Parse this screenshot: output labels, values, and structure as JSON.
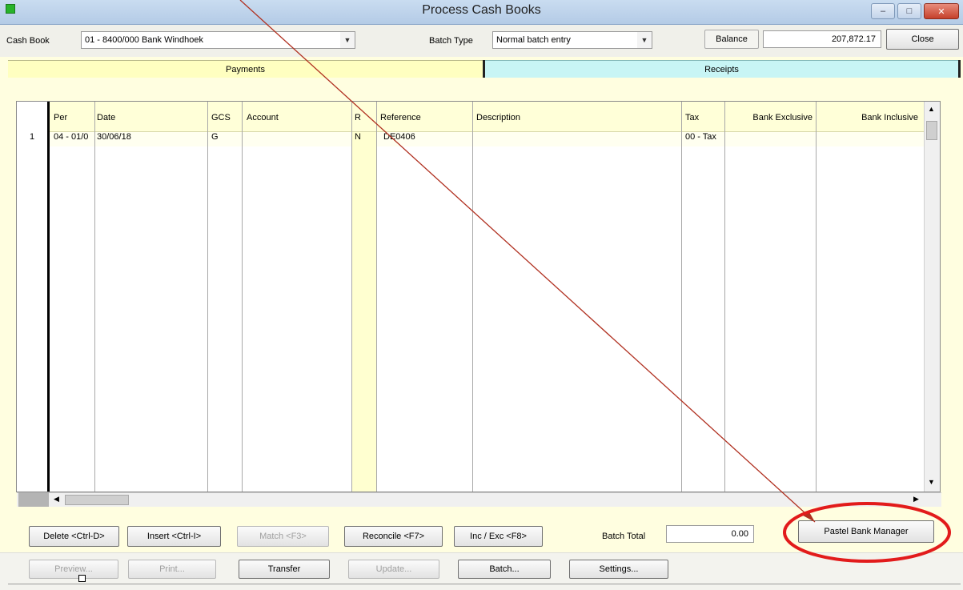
{
  "window": {
    "title": "Process Cash Books",
    "minimize_glyph": "–",
    "maximize_glyph": "□",
    "close_glyph": "✕"
  },
  "toolbar": {
    "cash_book_label": "Cash Book",
    "cash_book_value": "01 - 8400/000 Bank Windhoek",
    "batch_type_label": "Batch Type",
    "batch_type_value": "Normal batch entry",
    "balance_label": "Balance",
    "balance_value": "207,872.17",
    "close_label": "Close"
  },
  "tabs": [
    {
      "label": "Payments",
      "active": true
    },
    {
      "label": "Receipts",
      "active": false
    }
  ],
  "grid": {
    "columns": [
      "Per",
      "Date",
      "GCS",
      "Account",
      "R",
      "Reference",
      "Description",
      "Tax",
      "Bank Exclusive",
      "Bank Inclusive"
    ],
    "rows": [
      {
        "row_no": "1",
        "per": "04 - 01/0",
        "date": "30/06/18",
        "gcs": "G",
        "account": "",
        "r": "N",
        "reference": "DE0406",
        "description": "",
        "tax": "00 - Tax",
        "bank_exclusive": "",
        "bank_inclusive": ""
      }
    ]
  },
  "actions": {
    "delete": "Delete <Ctrl-D>",
    "insert": "Insert <Ctrl-I>",
    "match": "Match <F3>",
    "reconcile": "Reconcile <F7>",
    "inc_exc": "Inc / Exc <F8>",
    "batch_total_label": "Batch Total",
    "batch_total_value": "0.00",
    "bank_manager": "Pastel Bank Manager"
  },
  "bottom_bar": {
    "preview": "Preview...",
    "print": "Print...",
    "transfer": "Transfer",
    "update": "Update...",
    "batch": "Batch...",
    "settings": "Settings..."
  },
  "colors": {
    "background": "#fffee0",
    "payments_tab": "#ffffc0",
    "receipts_tab": "#c8f5f5",
    "annotation": "#c0392b",
    "highlight_circle": "#e21b1b"
  }
}
